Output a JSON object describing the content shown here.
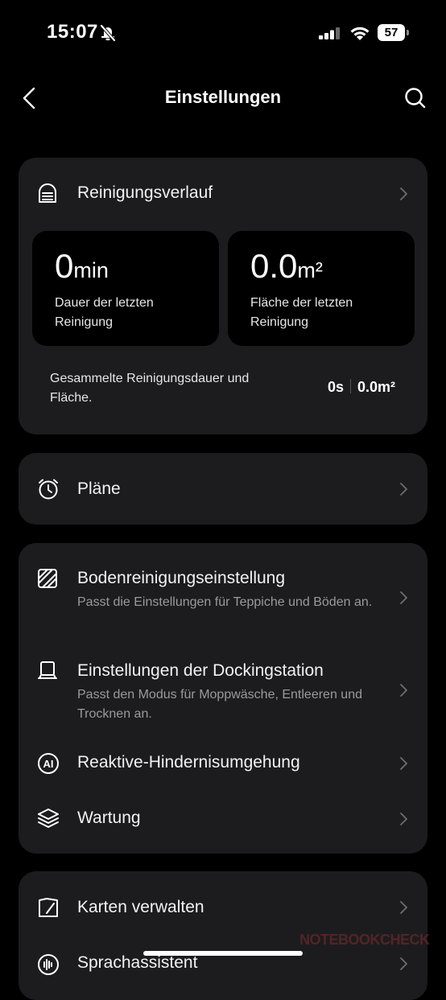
{
  "status_bar": {
    "time": "15:07",
    "battery": "57"
  },
  "header": {
    "title": "Einstellungen"
  },
  "history": {
    "label": "Reinigungsverlauf",
    "last_duration": {
      "value": "0",
      "unit": "min",
      "label": "Dauer der letzten Reinigung"
    },
    "last_area": {
      "value": "0.0",
      "unit": "m²",
      "label": "Fläche der letzten Reinigung"
    },
    "total": {
      "label": "Gesammelte Reinigungsdauer und Fläche.",
      "duration": "0s",
      "area": "0.0m²"
    }
  },
  "schedules": {
    "label": "Pläne"
  },
  "settings": {
    "floor": {
      "label": "Bodenreinigungseinstellung",
      "desc": "Passt die Einstellungen für Teppiche und Böden an."
    },
    "dock": {
      "label": "Einstellungen der Dockingstation",
      "desc": "Passt den Modus für Moppwäsche, Entleeren und Trocknen an."
    },
    "obstacle": {
      "label": "Reaktive-Hindernisumgehung",
      "icon_text": "AI"
    },
    "maintenance": {
      "label": "Wartung"
    }
  },
  "maps": {
    "label": "Karten verwalten"
  },
  "voice": {
    "label": "Sprachassistent"
  },
  "watermark": "NOTEBOOKCHECK"
}
